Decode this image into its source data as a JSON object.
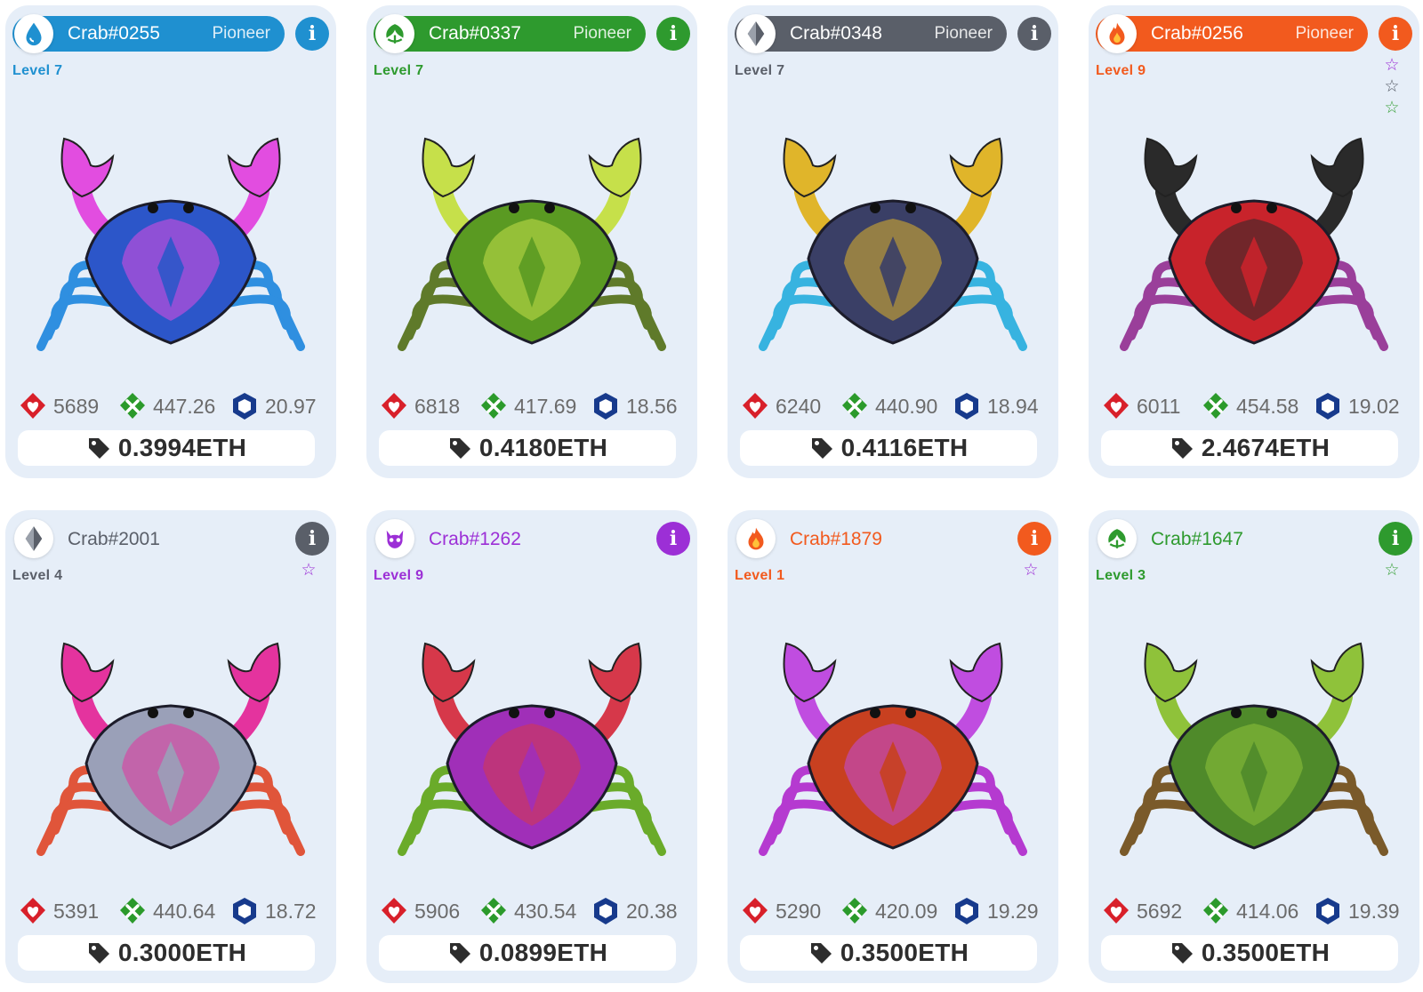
{
  "cards": [
    {
      "id": "Crab#0255",
      "tier": "Pioneer",
      "level": "Level 7",
      "class_icon": "water-drop-icon",
      "color": "#1f90d0",
      "stars": [],
      "hp": "5689",
      "atk": "447.26",
      "def": "20.97",
      "price": "0.3994ETH"
    },
    {
      "id": "Crab#0337",
      "tier": "Pioneer",
      "level": "Level 7",
      "class_icon": "leaf-icon",
      "color": "#2e9a2e",
      "stars": [],
      "hp": "6818",
      "atk": "417.69",
      "def": "18.56",
      "price": "0.4180ETH"
    },
    {
      "id": "Crab#0348",
      "tier": "Pioneer",
      "level": "Level 7",
      "class_icon": "diamond-icon",
      "color": "#5a5f69",
      "stars": [],
      "hp": "6240",
      "atk": "440.90",
      "def": "18.94",
      "price": "0.4116ETH"
    },
    {
      "id": "Crab#0256",
      "tier": "Pioneer",
      "level": "Level 9",
      "class_icon": "fire-icon",
      "color": "#f25a1e",
      "stars": [
        "#9c2fd6",
        "#555b66",
        "#3aa13a"
      ],
      "hp": "6011",
      "atk": "454.58",
      "def": "19.02",
      "price": "2.4674ETH"
    },
    {
      "id": "Crab#2001",
      "tier": "",
      "level": "Level 4",
      "class_icon": "diamond-icon",
      "color": "#5a5f69",
      "stars": [
        "#9c2fd6"
      ],
      "hp": "5391",
      "atk": "440.64",
      "def": "18.72",
      "price": "0.3000ETH"
    },
    {
      "id": "Crab#1262",
      "tier": "",
      "level": "Level 9",
      "class_icon": "demon-icon",
      "color": "#9c2fd6",
      "stars": [],
      "hp": "5906",
      "atk": "430.54",
      "def": "20.38",
      "price": "0.0899ETH"
    },
    {
      "id": "Crab#1879",
      "tier": "",
      "level": "Level 1",
      "class_icon": "fire-icon",
      "color": "#f25a1e",
      "stars": [
        "#9c2fd6"
      ],
      "hp": "5290",
      "atk": "420.09",
      "def": "19.29",
      "price": "0.3500ETH"
    },
    {
      "id": "Crab#1647",
      "tier": "",
      "level": "Level 3",
      "class_icon": "leaf-icon",
      "color": "#2e9a2e",
      "stars": [
        "#3aa13a"
      ],
      "hp": "5692",
      "atk": "414.06",
      "def": "19.39",
      "price": "0.3500ETH"
    }
  ],
  "stat_colors": {
    "hp": "#d8202a",
    "atk": "#2b9a2b",
    "def": "#173a8c"
  },
  "crab_palettes": [
    {
      "body": "#2c56c9",
      "accent": "#e24de0",
      "legs": "#2f8fe0"
    },
    {
      "body": "#5a9a22",
      "accent": "#c6e04a",
      "legs": "#5f7a2a"
    },
    {
      "body": "#3a3f66",
      "accent": "#e0b52a",
      "legs": "#37b3e0"
    },
    {
      "body": "#c8232b",
      "accent": "#2a2a2a",
      "legs": "#9a3f9a"
    },
    {
      "body": "#9aa0b8",
      "accent": "#e4339e",
      "legs": "#e0553a"
    },
    {
      "body": "#a02fb8",
      "accent": "#d6384a",
      "legs": "#6aab2a"
    },
    {
      "body": "#c84020",
      "accent": "#c04de0",
      "legs": "#b53ad0"
    },
    {
      "body": "#4f8a2a",
      "accent": "#8fc23a",
      "legs": "#7a5a2a"
    }
  ]
}
